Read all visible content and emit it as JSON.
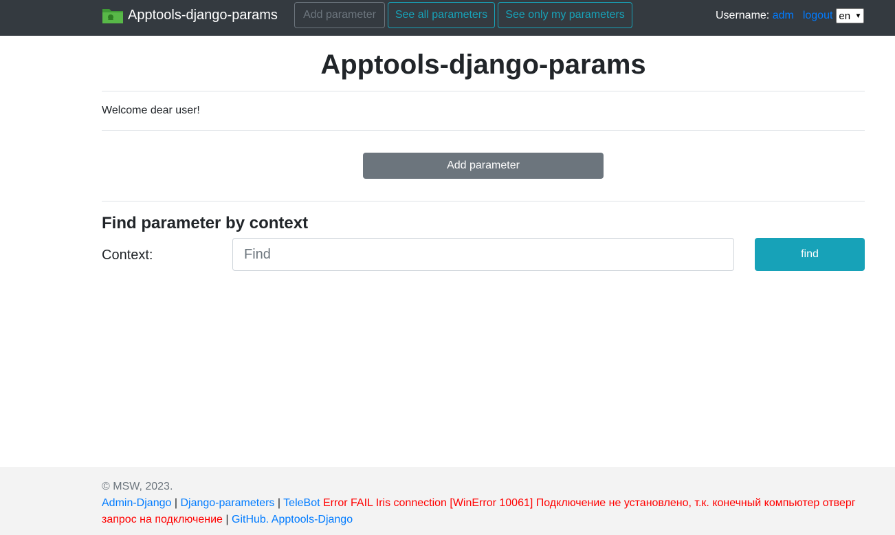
{
  "navbar": {
    "brand": "Apptools-django-params",
    "add_parameter": "Add parameter",
    "see_all": "See all parameters",
    "see_mine": "See only my parameters",
    "username_label": "Username:",
    "username": "adm",
    "logout": "logout",
    "language": "en"
  },
  "main": {
    "title": "Apptools-django-params",
    "welcome": "Welcome dear user!",
    "add_parameter_button": "Add parameter",
    "find_section_title": "Find parameter by context",
    "context_label": "Context:",
    "find_placeholder": "Find",
    "find_button": "find"
  },
  "footer": {
    "copyright": "© MSW, 2023.",
    "link_admin": "Admin-Django",
    "link_params": "Django-parameters",
    "link_telebot": "TeleBot",
    "error_text": "Error FAIL Iris connection [WinError 10061] Подключение не установлено, т.к. конечный компьютер отверг запрос на подключение",
    "link_github": "GitHub. Apptools-Django",
    "separator": "|"
  },
  "colors": {
    "navbar_bg": "#343a40",
    "info": "#17a2b8",
    "secondary": "#6c757d",
    "link": "#007bff",
    "error": "#ff0000",
    "footer_bg": "#f3f3f3"
  }
}
